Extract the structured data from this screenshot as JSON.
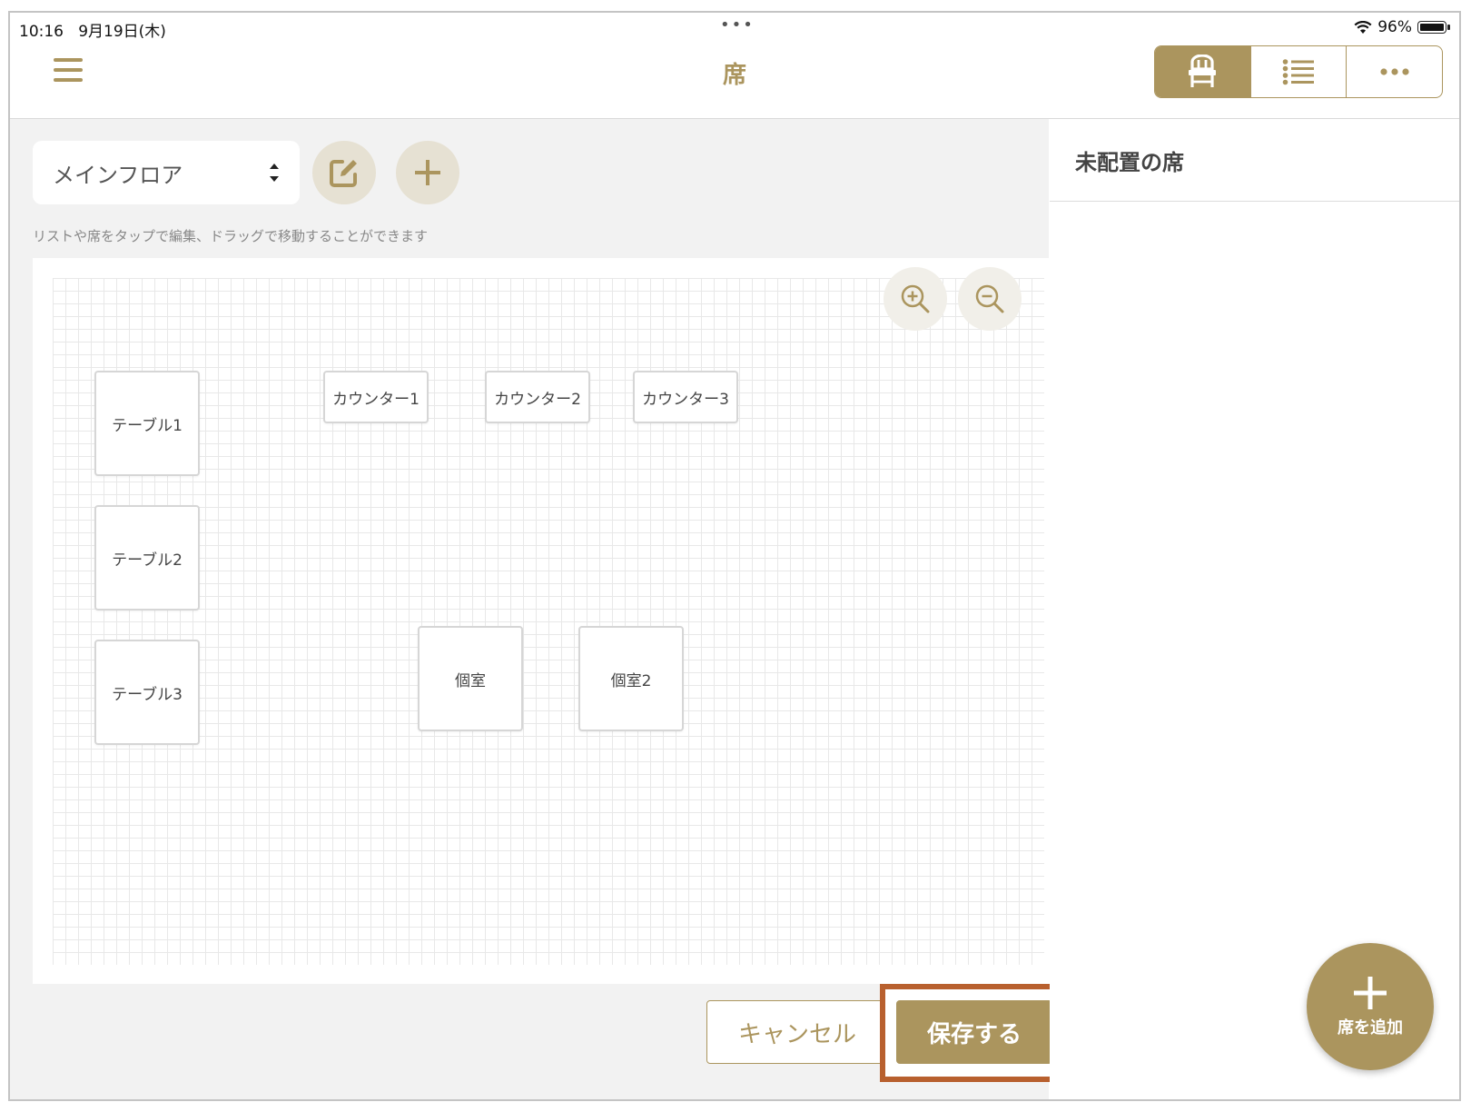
{
  "status_bar": {
    "time": "10:16",
    "date": "9月19日(木)",
    "dots": "•••",
    "battery_percent": "96%"
  },
  "header": {
    "title": "席",
    "segments": [
      {
        "icon": "chair-icon",
        "active": true
      },
      {
        "icon": "list-icon",
        "active": false
      },
      {
        "icon": "more-icon",
        "active": false
      }
    ]
  },
  "toolbar": {
    "floor_select_value": "メインフロア",
    "hint": "リストや席をタップで編集、ドラッグで移動することができます"
  },
  "seats": [
    {
      "label": "テーブル1"
    },
    {
      "label": "テーブル2"
    },
    {
      "label": "テーブル3"
    },
    {
      "label": "カウンター1"
    },
    {
      "label": "カウンター2"
    },
    {
      "label": "カウンター3"
    },
    {
      "label": "個室"
    },
    {
      "label": "個室2"
    }
  ],
  "actions": {
    "cancel_label": "キャンセル",
    "save_label": "保存する"
  },
  "side_panel": {
    "title": "未配置の席",
    "fab_label": "席を追加"
  },
  "colors": {
    "accent": "#ab955e",
    "highlight": "#b8602e",
    "background": "#f2f2f2"
  }
}
